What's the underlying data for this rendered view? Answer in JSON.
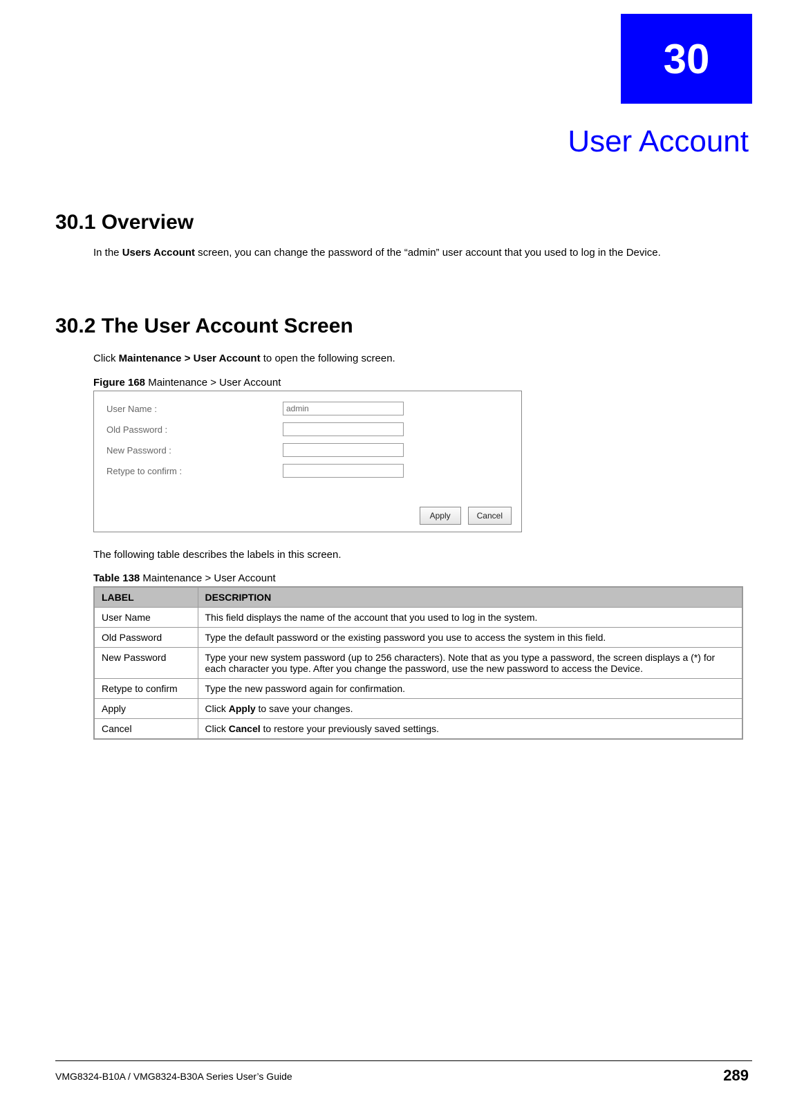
{
  "chapter": {
    "number": "30",
    "title": "User Account"
  },
  "section_overview": {
    "heading": "30.1  Overview",
    "text_before_bold": "In the ",
    "bold1": "Users Account",
    "text_after": " screen, you can change the password of the “admin” user account that you used to log in the Device."
  },
  "section_screen": {
    "heading": "30.2  The User Account Screen",
    "click_before": "Click ",
    "click_bold": "Maintenance >  User Account",
    "click_after": " to open the following screen.",
    "figure_prefix": "Figure 168",
    "figure_rest": "   Maintenance >  User Account",
    "form": {
      "row1_label": "User Name :",
      "row1_value": "admin",
      "row2_label": "Old Password :",
      "row3_label": "New Password :",
      "row4_label": "Retype to confirm :",
      "apply": "Apply",
      "cancel": "Cancel"
    },
    "following_text": "The following table describes the labels in this screen.",
    "table_prefix": "Table 138",
    "table_rest": "   Maintenance >  User Account",
    "table_head_label": "LABEL",
    "table_head_desc": "DESCRIPTION",
    "rows": [
      {
        "label": "User Name",
        "desc": "This field displays the name of the account that you used to log in the system."
      },
      {
        "label": "Old Password",
        "desc": "Type the default password or the existing password you use to access the system in this field."
      },
      {
        "label": "New Password",
        "desc": "Type your new system password (up to 256 characters). Note that as you type a password, the screen displays a (*) for each character you type. After you change the password, use the new password to access the Device."
      },
      {
        "label": "Retype to confirm",
        "desc": "Type the new password again for confirmation."
      },
      {
        "label": "Apply",
        "desc_pre": "Click ",
        "desc_bold": "Apply",
        "desc_post": " to save your changes."
      },
      {
        "label": "Cancel",
        "desc_pre": "Click ",
        "desc_bold": "Cancel",
        "desc_post": " to restore your previously saved settings."
      }
    ]
  },
  "footer": {
    "left": "VMG8324-B10A / VMG8324-B30A Series User’s Guide",
    "right": "289"
  }
}
